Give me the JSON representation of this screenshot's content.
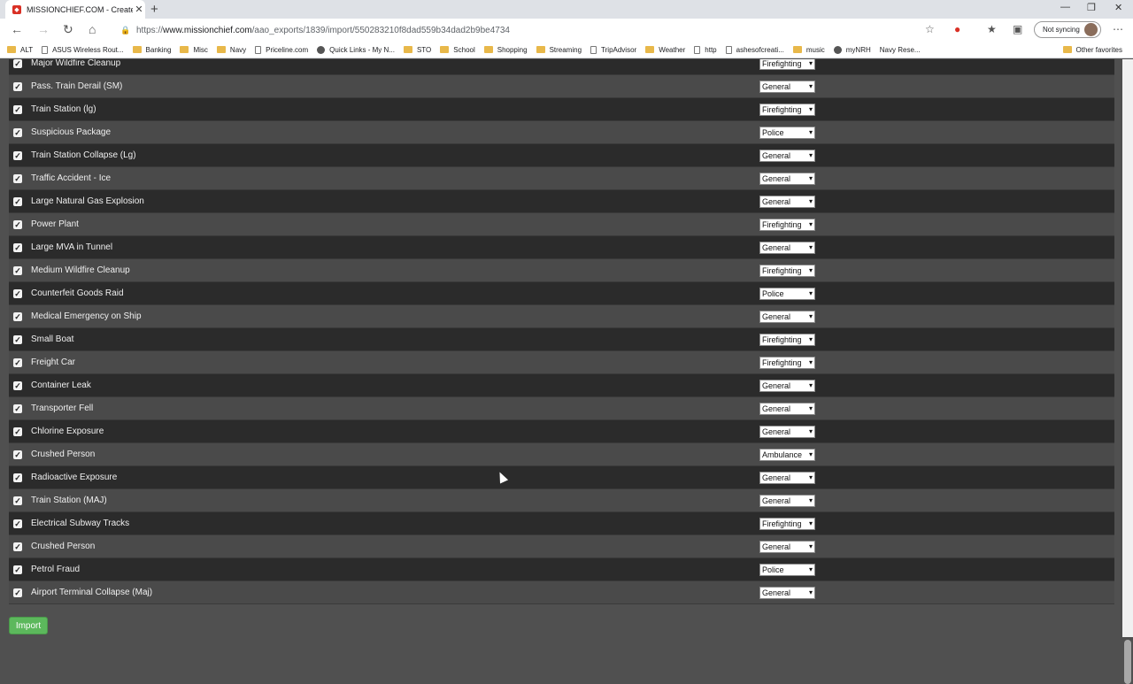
{
  "browser": {
    "tab_title": "MISSIONCHIEF.COM - Create yo",
    "tab_close": "✕",
    "new_tab": "+",
    "url_prefix": "https://",
    "url_host": "www.missionchief.com",
    "url_path": "/aao_exports/1839/import/550283210f8dad559b34dad2b9be4734",
    "sync_label": "Not syncing",
    "window_controls": [
      "—",
      "❐",
      "✕"
    ],
    "icons": [
      "back-icon",
      "forward-icon",
      "reload-icon",
      "home-icon",
      "lock-icon",
      "favorite-add-icon",
      "extension-icon",
      "favorites-icon",
      "collections-icon",
      "more-icon"
    ]
  },
  "bookmarks": [
    {
      "label": "ALT",
      "icon": "folder"
    },
    {
      "label": "ASUS Wireless Rout...",
      "icon": "page"
    },
    {
      "label": "Banking",
      "icon": "folder"
    },
    {
      "label": "Misc",
      "icon": "folder"
    },
    {
      "label": "Navy",
      "icon": "folder"
    },
    {
      "label": "Priceline.com",
      "icon": "page"
    },
    {
      "label": "Quick Links - My N...",
      "icon": "globe"
    },
    {
      "label": "STO",
      "icon": "folder"
    },
    {
      "label": "School",
      "icon": "folder"
    },
    {
      "label": "Shopping",
      "icon": "folder"
    },
    {
      "label": "Streaming",
      "icon": "folder"
    },
    {
      "label": "TripAdvisor",
      "icon": "page"
    },
    {
      "label": "Weather",
      "icon": "folder"
    },
    {
      "label": "http",
      "icon": "page"
    },
    {
      "label": "ashesofcreati...",
      "icon": "page"
    },
    {
      "label": "music",
      "icon": "folder"
    },
    {
      "label": "myNRH",
      "icon": "globe"
    },
    {
      "label": "Navy Rese...",
      "icon": "none"
    }
  ],
  "bookmarks_other": "Other favorites",
  "missions": [
    {
      "name": "Major Wildfire Cleanup",
      "category": "Firefighting",
      "checked": true
    },
    {
      "name": "Pass. Train Derail (SM)",
      "category": "General",
      "checked": true
    },
    {
      "name": "Train Station (lg)",
      "category": "Firefighting",
      "checked": true
    },
    {
      "name": "Suspicious Package",
      "category": "Police",
      "checked": true
    },
    {
      "name": "Train Station Collapse (Lg)",
      "category": "General",
      "checked": true
    },
    {
      "name": "Traffic Accident - Ice",
      "category": "General",
      "checked": true
    },
    {
      "name": "Large Natural Gas Explosion",
      "category": "General",
      "checked": true
    },
    {
      "name": "Power Plant",
      "category": "Firefighting",
      "checked": true
    },
    {
      "name": "Large MVA in Tunnel",
      "category": "General",
      "checked": true
    },
    {
      "name": "Medium Wildfire Cleanup",
      "category": "Firefighting",
      "checked": true
    },
    {
      "name": "Counterfeit Goods Raid",
      "category": "Police",
      "checked": true
    },
    {
      "name": "Medical Emergency on Ship",
      "category": "General",
      "checked": true
    },
    {
      "name": "Small Boat",
      "category": "Firefighting",
      "checked": true
    },
    {
      "name": "Freight Car",
      "category": "Firefighting",
      "checked": true
    },
    {
      "name": "Container Leak",
      "category": "General",
      "checked": true
    },
    {
      "name": "Transporter Fell",
      "category": "General",
      "checked": true
    },
    {
      "name": "Chlorine Exposure",
      "category": "General",
      "checked": true
    },
    {
      "name": "Crushed Person",
      "category": "Ambulance",
      "checked": true
    },
    {
      "name": "Radioactive Exposure",
      "category": "General",
      "checked": true
    },
    {
      "name": "Train Station (MAJ)",
      "category": "General",
      "checked": true
    },
    {
      "name": "Electrical Subway Tracks",
      "category": "Firefighting",
      "checked": true
    },
    {
      "name": "Crushed Person",
      "category": "General",
      "checked": true
    },
    {
      "name": "Petrol Fraud",
      "category": "Police",
      "checked": true
    },
    {
      "name": "Airport Terminal Collapse (Maj)",
      "category": "General",
      "checked": true
    }
  ],
  "import_label": "Import"
}
